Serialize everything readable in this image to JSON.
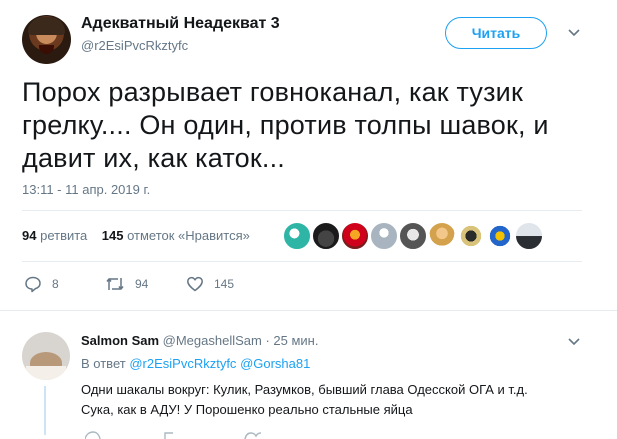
{
  "tweet": {
    "author_name": "Адекватный Неадекват 3",
    "author_handle": "@r2EsiPvcRkztyfc",
    "follow_label": "Читать",
    "text": "Порох разрывает говноканал, как тузик грелку.... Он один, против толпы шавок, и давит их, как каток...",
    "timestamp": "13:11 - 11 апр. 2019 г.",
    "retweets_count": "94",
    "retweets_label": "ретвита",
    "likes_count": "145",
    "likes_label": "отметок «Нравится»",
    "actions": {
      "replies": "8",
      "retweets": "94",
      "likes": "145"
    }
  },
  "reply": {
    "author_name": "Salmon Sam",
    "author_handle": "@MegashellSam",
    "time": "· 25 мин.",
    "reply_prefix": "В ответ",
    "mention_1": "@r2EsiPvcRkztyfc",
    "mention_2": "@Gorsha81",
    "line_1": "Одни шакалы вокруг: Кулик, Разумков, бывший глава Одесской ОГА и т.д.",
    "line_2": "Сука, как в АДУ! У Порошенко реально стальные яйца"
  },
  "colors": {
    "accent": "#1da1f2",
    "text": "#14171a",
    "secondary": "#657786",
    "separator": "#e6ecf0"
  }
}
